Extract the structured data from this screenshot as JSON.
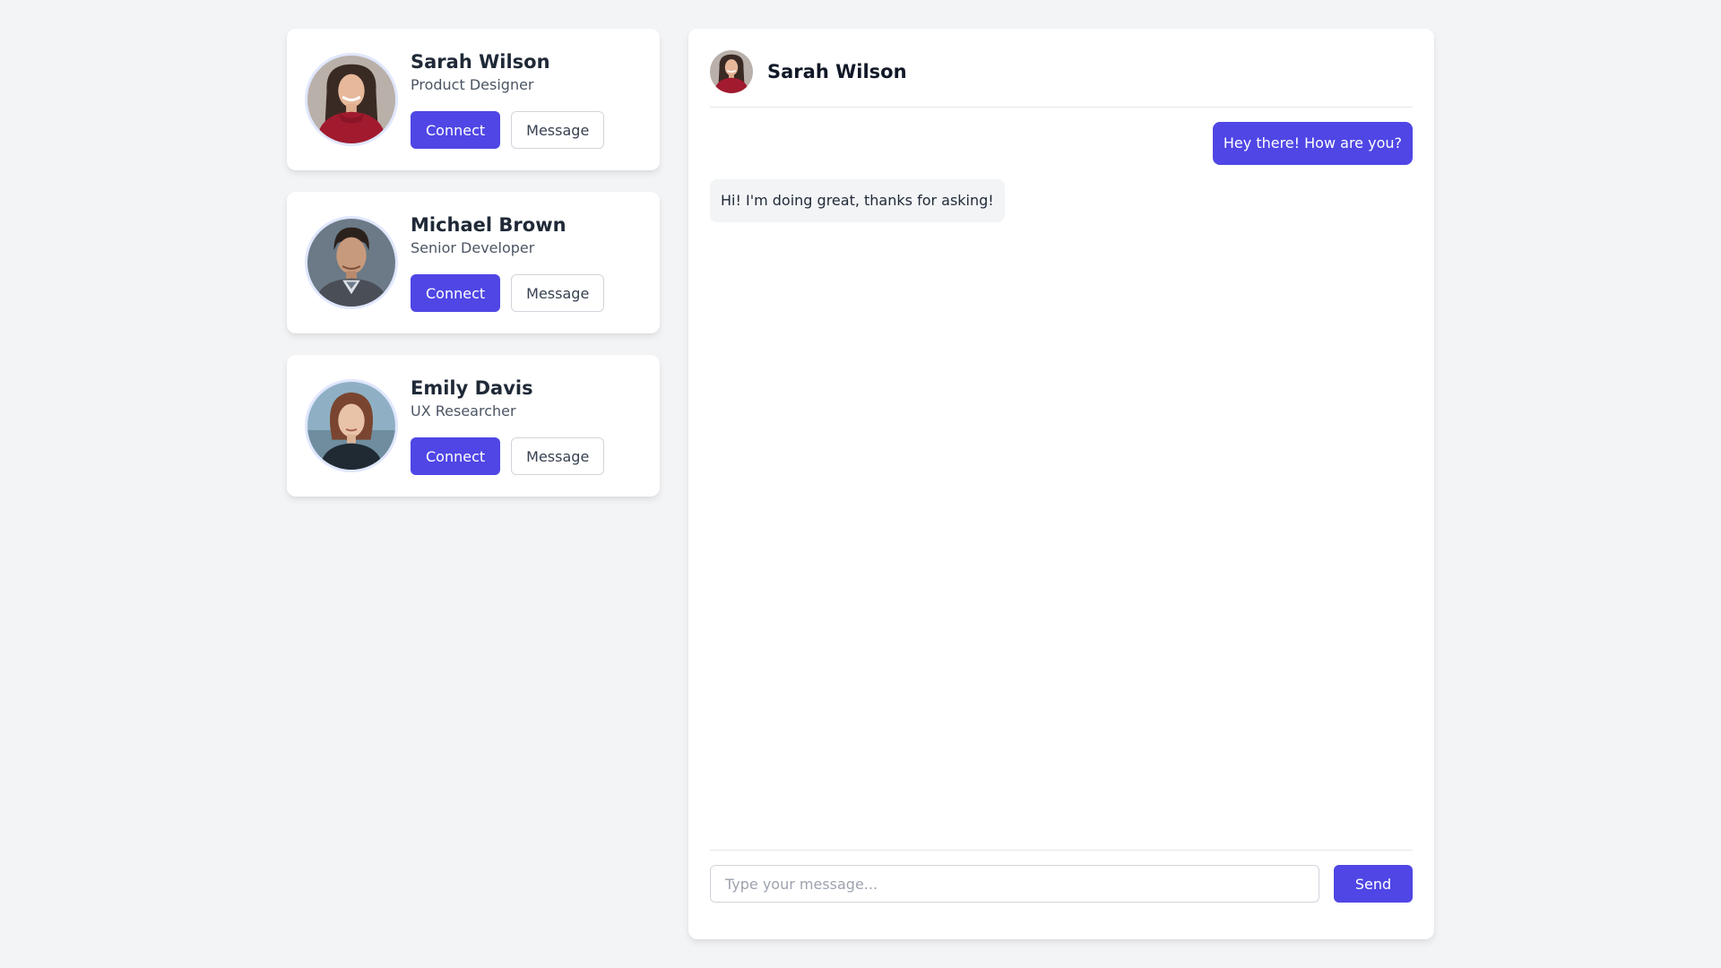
{
  "colors": {
    "accent": "#4f46e5",
    "background": "#f3f4f6",
    "card": "#ffffff",
    "received_bubble": "#f3f4f6"
  },
  "contacts": [
    {
      "name": "Sarah Wilson",
      "role": "Product Designer",
      "connect_label": "Connect",
      "message_label": "Message",
      "avatar": "woman-red-top-photo"
    },
    {
      "name": "Michael Brown",
      "role": "Senior Developer",
      "connect_label": "Connect",
      "message_label": "Message",
      "avatar": "man-dark-hair-photo"
    },
    {
      "name": "Emily Davis",
      "role": "UX Researcher",
      "connect_label": "Connect",
      "message_label": "Message",
      "avatar": "woman-auburn-hair-photo"
    }
  ],
  "chat": {
    "contact_name": "Sarah Wilson",
    "messages": [
      {
        "direction": "sent",
        "text": "Hey there! How are you?"
      },
      {
        "direction": "received",
        "text": "Hi! I'm doing great, thanks for asking!"
      }
    ],
    "input_placeholder": "Type your message...",
    "input_value": "",
    "send_label": "Send"
  }
}
